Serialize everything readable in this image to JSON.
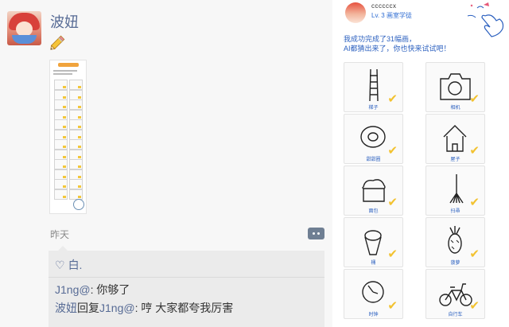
{
  "post": {
    "username": "波妞",
    "time": "昨天",
    "likes_label": "白.",
    "comments": [
      {
        "name": "J1ng@",
        "sep": ": ",
        "text": "你够了"
      },
      {
        "name": "波妞",
        "reply_word": "回复",
        "target": "J1ng@",
        "sep": ": ",
        "text": "哼 大家都夸我厉害"
      }
    ]
  },
  "result": {
    "username": "ccccccx",
    "level": "Lv. 3 画室学徒",
    "line1": "我成功完成了31幅画，",
    "line2": "AI都猜出来了，你也快来试试吧！",
    "items": [
      {
        "label": "梯子",
        "icon": "ladder-drawing"
      },
      {
        "label": "相机",
        "icon": "camera-drawing"
      },
      {
        "label": "甜甜圈",
        "icon": "donut-drawing"
      },
      {
        "label": "屋子",
        "icon": "house-drawing"
      },
      {
        "label": "面包",
        "icon": "bread-drawing"
      },
      {
        "label": "扫帚",
        "icon": "broom-drawing"
      },
      {
        "label": "桶",
        "icon": "bucket-drawing"
      },
      {
        "label": "菠萝",
        "icon": "pineapple-drawing"
      },
      {
        "label": "时钟",
        "icon": "clock-drawing"
      },
      {
        "label": "自行车",
        "icon": "bicycle-drawing"
      }
    ]
  },
  "colors": {
    "name_blue": "#576b95",
    "check_yellow": "#f2c230",
    "caption_blue": "#2a5fbf",
    "panel_bg": "#ebebeb"
  }
}
